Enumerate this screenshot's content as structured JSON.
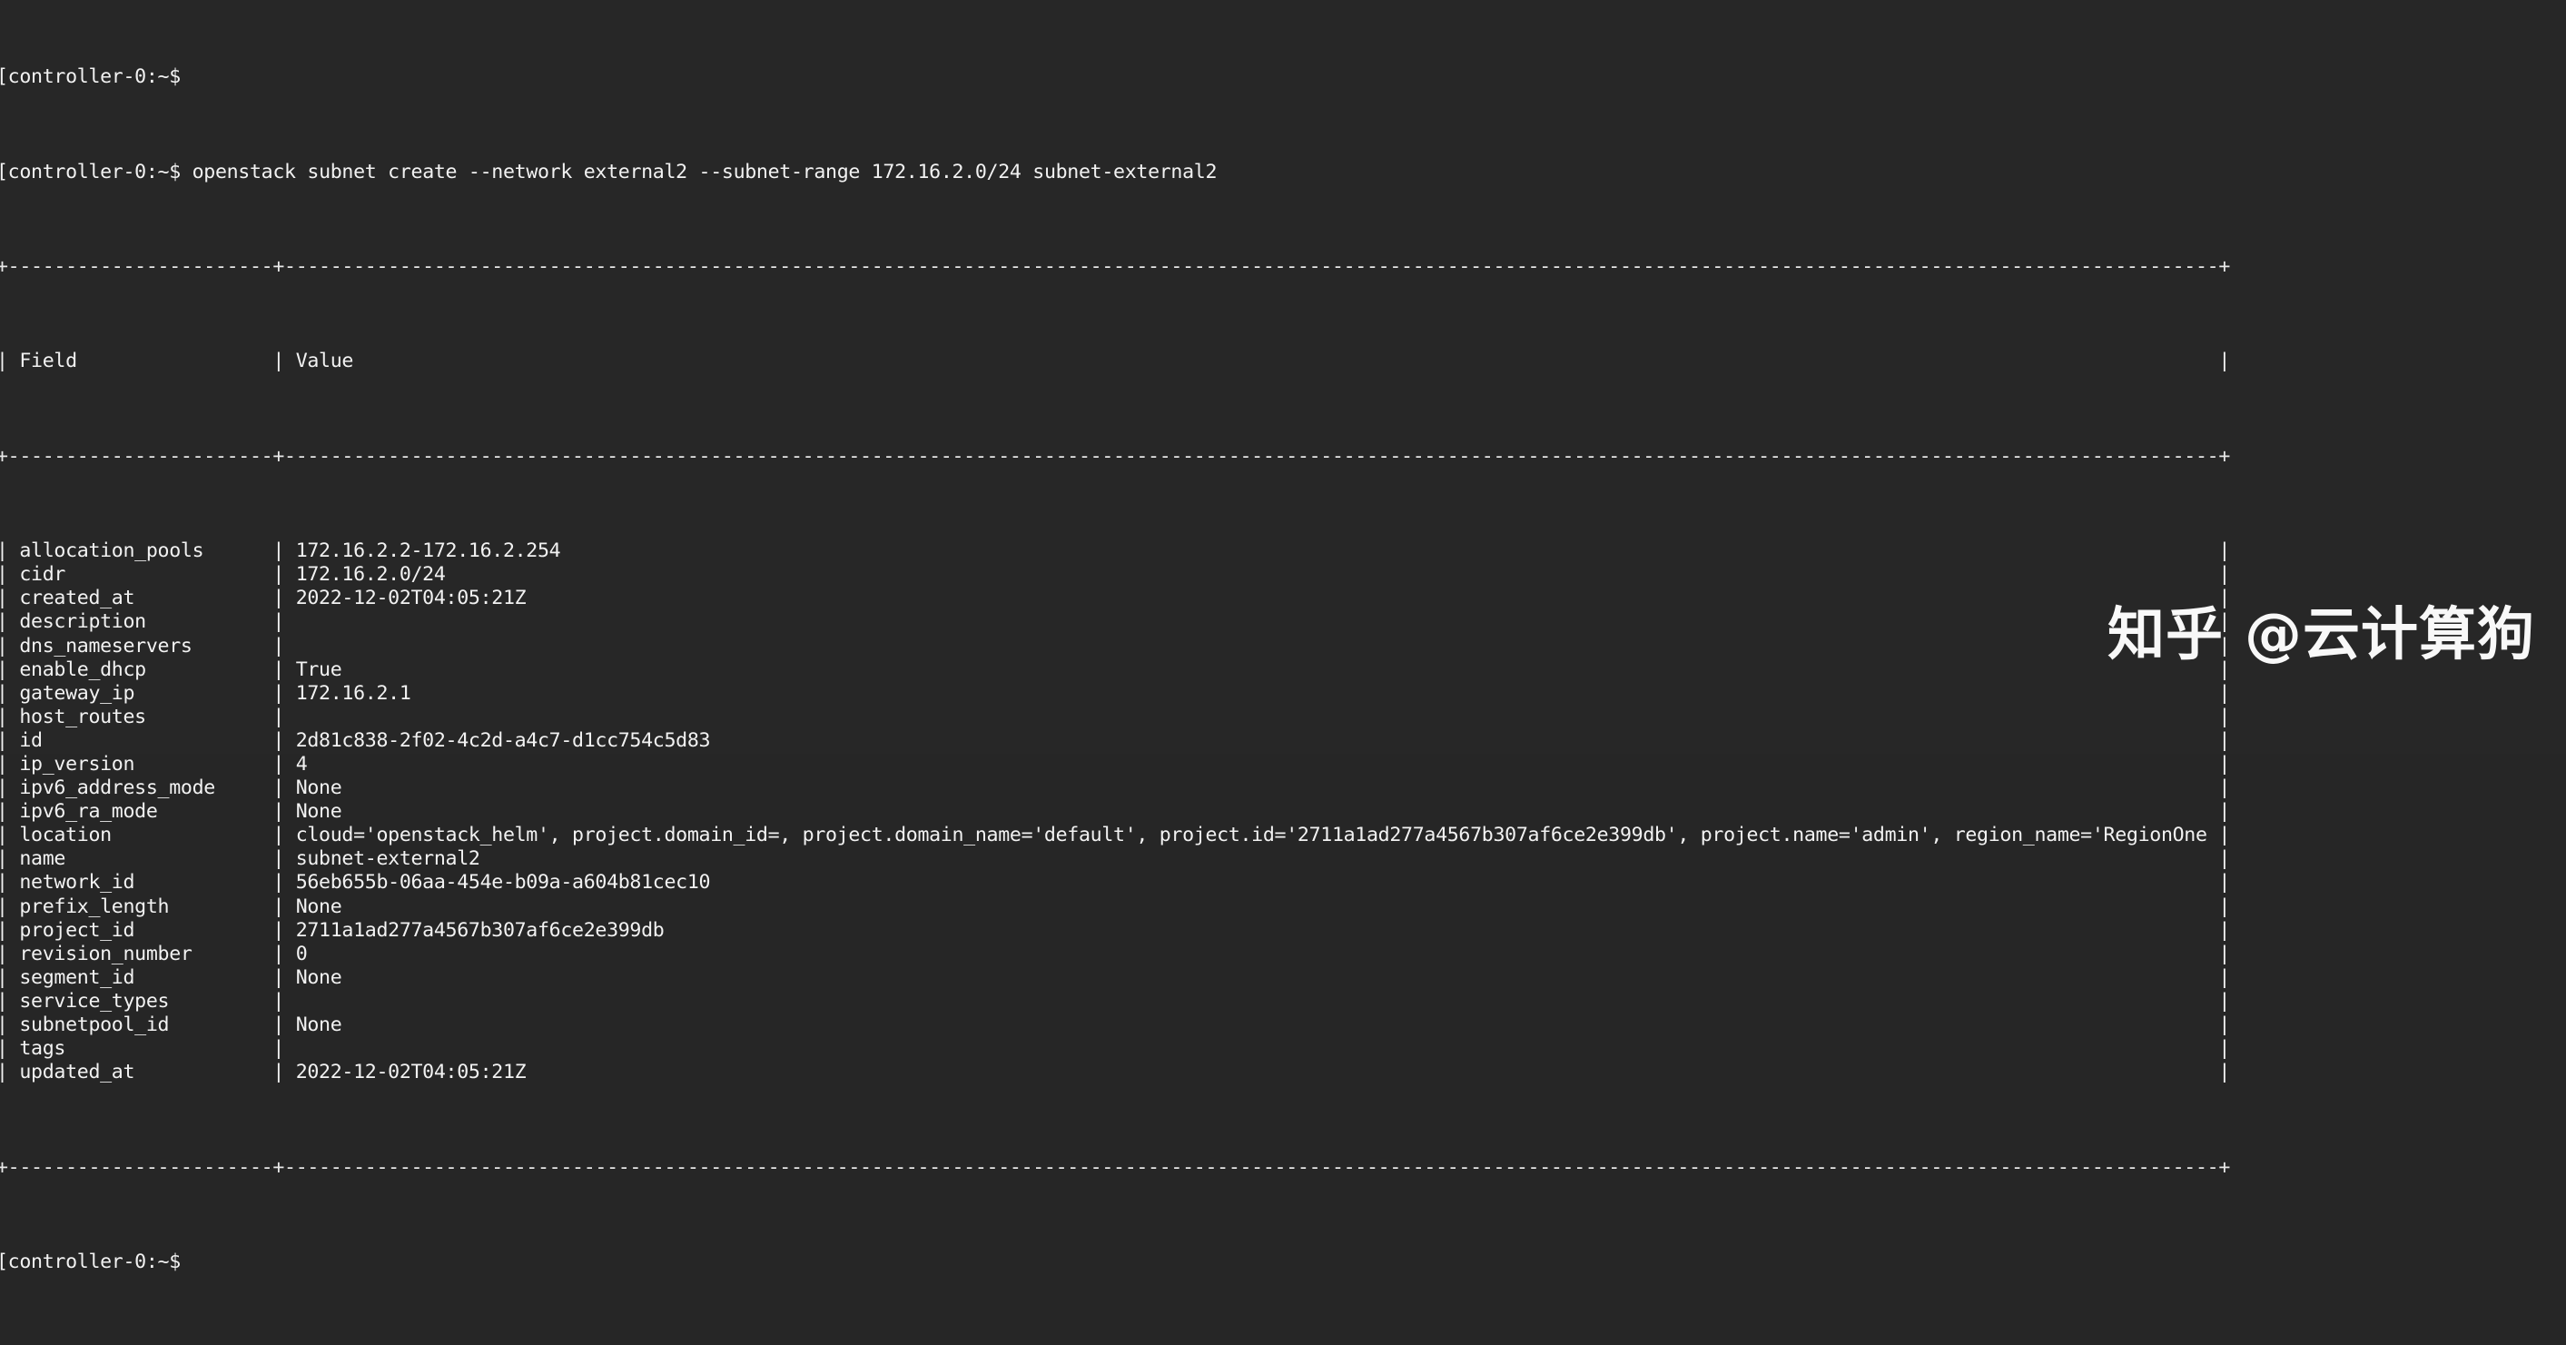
{
  "terminal": {
    "theme": {
      "background": "#272727",
      "foreground": "#f2f2f2"
    },
    "prompt": "[controller-0:~$",
    "command": "openstack subnet create --network external2 --subnet-range 172.16.2.0/24 subnet-external2",
    "blank_first_line": "[controller-0:~$",
    "trailing_prompt": "[controller-0:~$",
    "table": {
      "columns": [
        "Field",
        "Value"
      ],
      "field_column_width": 21,
      "rows": [
        {
          "field": "allocation_pools",
          "value": "172.16.2.2-172.16.2.254"
        },
        {
          "field": "cidr",
          "value": "172.16.2.0/24"
        },
        {
          "field": "created_at",
          "value": "2022-12-02T04:05:21Z"
        },
        {
          "field": "description",
          "value": ""
        },
        {
          "field": "dns_nameservers",
          "value": ""
        },
        {
          "field": "enable_dhcp",
          "value": "True"
        },
        {
          "field": "gateway_ip",
          "value": "172.16.2.1"
        },
        {
          "field": "host_routes",
          "value": ""
        },
        {
          "field": "id",
          "value": "2d81c838-2f02-4c2d-a4c7-d1cc754c5d83"
        },
        {
          "field": "ip_version",
          "value": "4"
        },
        {
          "field": "ipv6_address_mode",
          "value": "None"
        },
        {
          "field": "ipv6_ra_mode",
          "value": "None"
        },
        {
          "field": "location",
          "value": "cloud='openstack_helm', project.domain_id=, project.domain_name='default', project.id='2711a1ad277a4567b307af6ce2e399db', project.name='admin', region_name='RegionOne', zone="
        },
        {
          "field": "name",
          "value": "subnet-external2"
        },
        {
          "field": "network_id",
          "value": "56eb655b-06aa-454e-b09a-a604b81cec10"
        },
        {
          "field": "prefix_length",
          "value": "None"
        },
        {
          "field": "project_id",
          "value": "2711a1ad277a4567b307af6ce2e399db"
        },
        {
          "field": "revision_number",
          "value": "0"
        },
        {
          "field": "segment_id",
          "value": "None"
        },
        {
          "field": "service_types",
          "value": ""
        },
        {
          "field": "subnetpool_id",
          "value": "None"
        },
        {
          "field": "tags",
          "value": ""
        },
        {
          "field": "updated_at",
          "value": "2022-12-02T04:05:21Z"
        }
      ]
    }
  },
  "watermark": {
    "text": "知乎 @云计算狗"
  }
}
